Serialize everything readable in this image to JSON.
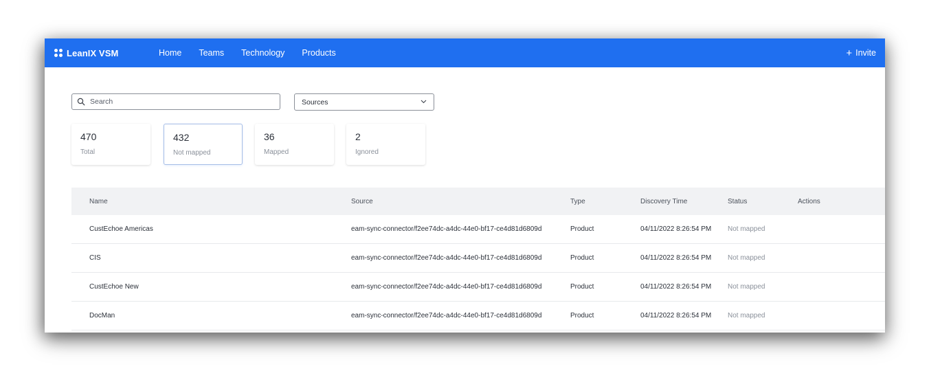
{
  "app": {
    "brand": "LeanIX VSM"
  },
  "nav": {
    "items": [
      {
        "label": "Home"
      },
      {
        "label": "Teams"
      },
      {
        "label": "Technology"
      },
      {
        "label": "Products"
      }
    ],
    "invite_label": "Invite"
  },
  "filters": {
    "search_placeholder": "Search",
    "sources_label": "Sources"
  },
  "stats": [
    {
      "value": "470",
      "label": "Total"
    },
    {
      "value": "432",
      "label": "Not mapped"
    },
    {
      "value": "36",
      "label": "Mapped"
    },
    {
      "value": "2",
      "label": "Ignored"
    }
  ],
  "table": {
    "headers": {
      "name": "Name",
      "source": "Source",
      "type": "Type",
      "time": "Discovery Time",
      "status": "Status",
      "actions": "Actions"
    },
    "rows": [
      {
        "name": "CustEchoe Americas",
        "source": "eam-sync-connector/f2ee74dc-a4dc-44e0-bf17-ce4d81d6809d",
        "type": "Product",
        "time": "04/11/2022 8:26:54 PM",
        "status": "Not mapped"
      },
      {
        "name": "CIS",
        "source": "eam-sync-connector/f2ee74dc-a4dc-44e0-bf17-ce4d81d6809d",
        "type": "Product",
        "time": "04/11/2022 8:26:54 PM",
        "status": "Not mapped"
      },
      {
        "name": "CustEchoe New",
        "source": "eam-sync-connector/f2ee74dc-a4dc-44e0-bf17-ce4d81d6809d",
        "type": "Product",
        "time": "04/11/2022 8:26:54 PM",
        "status": "Not mapped"
      },
      {
        "name": "DocMan",
        "source": "eam-sync-connector/f2ee74dc-a4dc-44e0-bf17-ce4d81d6809d",
        "type": "Product",
        "time": "04/11/2022 8:26:54 PM",
        "status": "Not mapped"
      }
    ]
  },
  "icons": {
    "logo": "leanix-logo-icon",
    "search": "search-icon",
    "dropdown": "chevron-down-icon",
    "invite": "plus-icon"
  },
  "colors": {
    "topbar": "#1f6ff0",
    "active_card_border": "#a6bde6",
    "muted_text": "#8a909a"
  }
}
